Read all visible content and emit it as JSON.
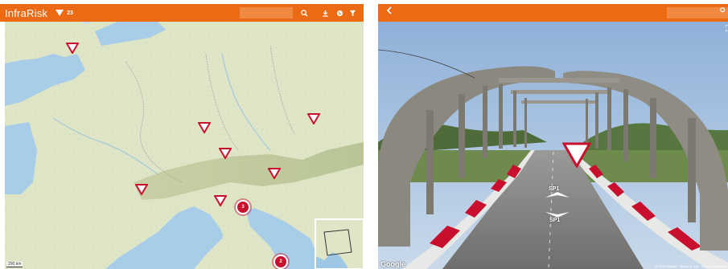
{
  "left": {
    "brand": "InfraRisk",
    "count": "23",
    "icons": [
      "search-icon",
      "download-icon",
      "globe-icon",
      "filter-icon"
    ],
    "clusters": [
      {
        "label": "3"
      },
      {
        "label": "2"
      }
    ],
    "scale": "200 km"
  },
  "right": {
    "back_icon": "chevron-left-icon",
    "road_labels": [
      "SP1",
      "SP1"
    ],
    "google": "Google",
    "copyright": "© 2019 Google · Terms of Use · Report a problem"
  },
  "colors": {
    "accent": "#ec6a14",
    "risk": "#c8102e"
  }
}
